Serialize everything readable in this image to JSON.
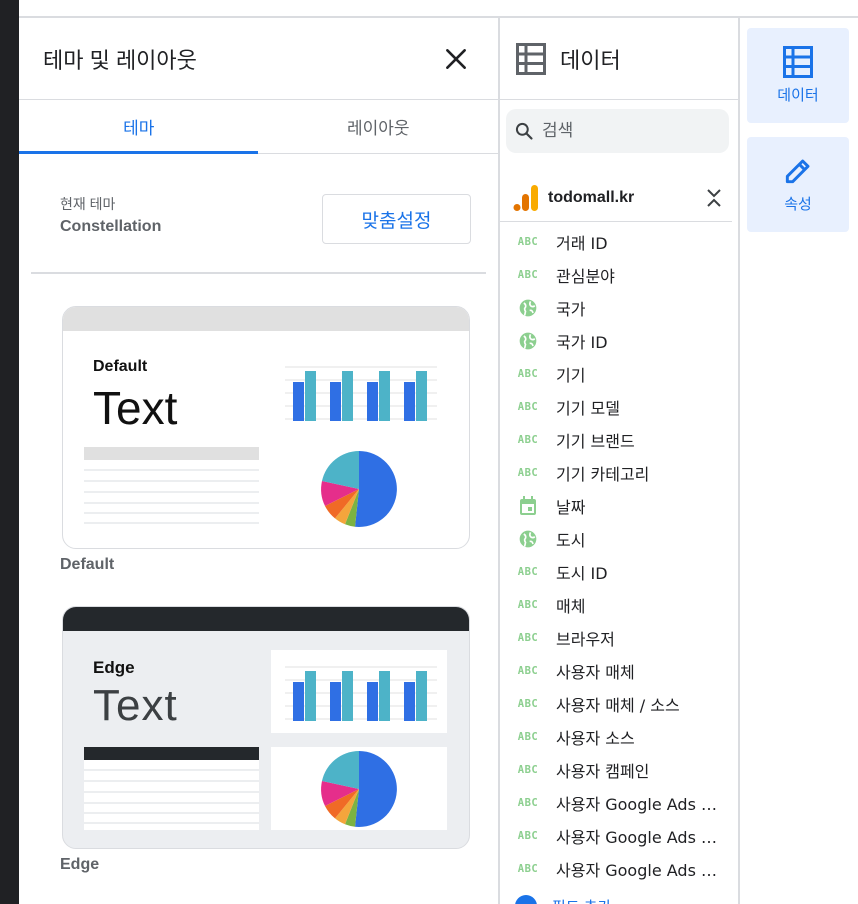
{
  "theme_panel": {
    "title": "테마 및 레이아웃",
    "tabs": [
      {
        "label": "테마",
        "active": true
      },
      {
        "label": "레이아웃",
        "active": false
      }
    ],
    "current_theme_label": "현재 테마",
    "current_theme_value": "Constellation",
    "customize_button": "맞춤설정",
    "themes": [
      {
        "card_name": "Default",
        "card_text": "Text",
        "label": "Default"
      },
      {
        "card_name": "Edge",
        "card_text": "Text",
        "label": "Edge"
      }
    ]
  },
  "data_panel": {
    "title": "데이터",
    "search_placeholder": "검색",
    "source_name": "todomall.kr",
    "fields": [
      {
        "icon": "abc-text-icon",
        "label": "거래 ID"
      },
      {
        "icon": "abc-text-icon",
        "label": "관심분야"
      },
      {
        "icon": "globe-icon",
        "label": "국가"
      },
      {
        "icon": "globe-icon",
        "label": "국가 ID"
      },
      {
        "icon": "abc-text-icon",
        "label": "기기"
      },
      {
        "icon": "abc-text-icon",
        "label": "기기 모델"
      },
      {
        "icon": "abc-text-icon",
        "label": "기기 브랜드"
      },
      {
        "icon": "abc-text-icon",
        "label": "기기 카테고리"
      },
      {
        "icon": "calendar-icon",
        "label": "날짜"
      },
      {
        "icon": "globe-icon",
        "label": "도시"
      },
      {
        "icon": "abc-text-icon",
        "label": "도시 ID"
      },
      {
        "icon": "abc-text-icon",
        "label": "매체"
      },
      {
        "icon": "abc-text-icon",
        "label": "브라우저"
      },
      {
        "icon": "abc-text-icon",
        "label": "사용자 매체"
      },
      {
        "icon": "abc-text-icon",
        "label": "사용자 매체 / 소스"
      },
      {
        "icon": "abc-text-icon",
        "label": "사용자 소스"
      },
      {
        "icon": "abc-text-icon",
        "label": "사용자 캠페인"
      },
      {
        "icon": "abc-text-icon",
        "label": "사용자 Google Ads 광…"
      },
      {
        "icon": "abc-text-icon",
        "label": "사용자 Google Ads 광…"
      },
      {
        "icon": "abc-text-icon",
        "label": "사용자 Google Ads 광…"
      }
    ],
    "abc_glyph": "ABC",
    "add_field_label": "필드 추가"
  },
  "rail": {
    "data_label": "데이터",
    "props_label": "속성"
  },
  "colors": {
    "accent": "#1a73e8",
    "dimension_green": "#8ccf8f",
    "bar_blue": "#2f6fe4",
    "bar_teal": "#4db3c8",
    "ga_orange": "#f9ab00",
    "ga_dark_orange": "#e37400"
  }
}
